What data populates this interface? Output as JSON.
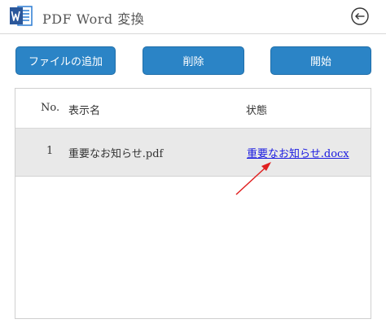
{
  "header": {
    "title": "PDF Word 変換",
    "logo_icon": "word-logo-icon",
    "back_icon": "back-arrow-icon"
  },
  "toolbar": {
    "add_label": "ファイルの追加",
    "delete_label": "削除",
    "start_label": "開始"
  },
  "table": {
    "columns": [
      "No.",
      "表示名",
      "状態"
    ],
    "rows": [
      {
        "no": "1",
        "name": "重要なお知らせ.pdf",
        "status": "重要なお知らせ.docx"
      }
    ]
  },
  "colors": {
    "button": "#2b84c6",
    "link": "#1a1ae0",
    "row_highlight": "#e9e9e9",
    "annotation": "#e02020"
  }
}
